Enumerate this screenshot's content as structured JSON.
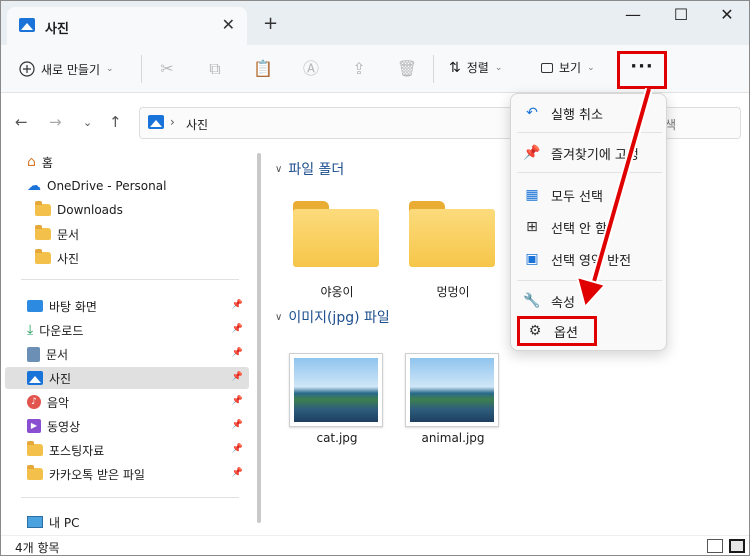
{
  "tab": {
    "title": "사진",
    "close": "✕",
    "new": "+"
  },
  "window_controls": {
    "minimize": "—",
    "maximize": "☐",
    "close": "✕"
  },
  "toolbar": {
    "new_label": "새로 만들기",
    "sort_label": "정렬",
    "view_label": "보기",
    "more_label": "···"
  },
  "address": {
    "path": "사진",
    "separator": "›"
  },
  "search": {
    "placeholder": "색"
  },
  "sidebar": {
    "items": [
      {
        "label": "홈"
      },
      {
        "label": "OneDrive - Personal"
      },
      {
        "label": "Downloads"
      },
      {
        "label": "문서"
      },
      {
        "label": "사진"
      },
      {
        "label": "바탕 화면"
      },
      {
        "label": "다운로드"
      },
      {
        "label": "문서"
      },
      {
        "label": "사진"
      },
      {
        "label": "음악"
      },
      {
        "label": "동영상"
      },
      {
        "label": "포스팅자료"
      },
      {
        "label": "카카오톡 받은 파일"
      },
      {
        "label": "내 PC"
      }
    ]
  },
  "content": {
    "folders_header": "파일 폴더",
    "images_header": "이미지(jpg) 파일",
    "folders": [
      {
        "name": "야옹이"
      },
      {
        "name": "멍멍이"
      }
    ],
    "files": [
      {
        "name": "cat.jpg"
      },
      {
        "name": "animal.jpg"
      }
    ]
  },
  "status": {
    "count": "4개 항목"
  },
  "menu": {
    "items": [
      {
        "label": "실행 취소",
        "icon": "undo-icon"
      },
      {
        "label": "즐겨찾기에 고정",
        "icon": "pin-icon"
      },
      {
        "label": "모두 선택",
        "icon": "select-all-icon"
      },
      {
        "label": "선택 안 함",
        "icon": "select-none-icon"
      },
      {
        "label": "선택 영역 반전",
        "icon": "invert-selection-icon"
      },
      {
        "label": "속성",
        "icon": "wrench-icon"
      },
      {
        "label": "옵션",
        "icon": "gear-icon"
      }
    ]
  },
  "colors": {
    "highlight": "#e10000",
    "accent": "#1a73d8",
    "folder": "#f6c649"
  }
}
